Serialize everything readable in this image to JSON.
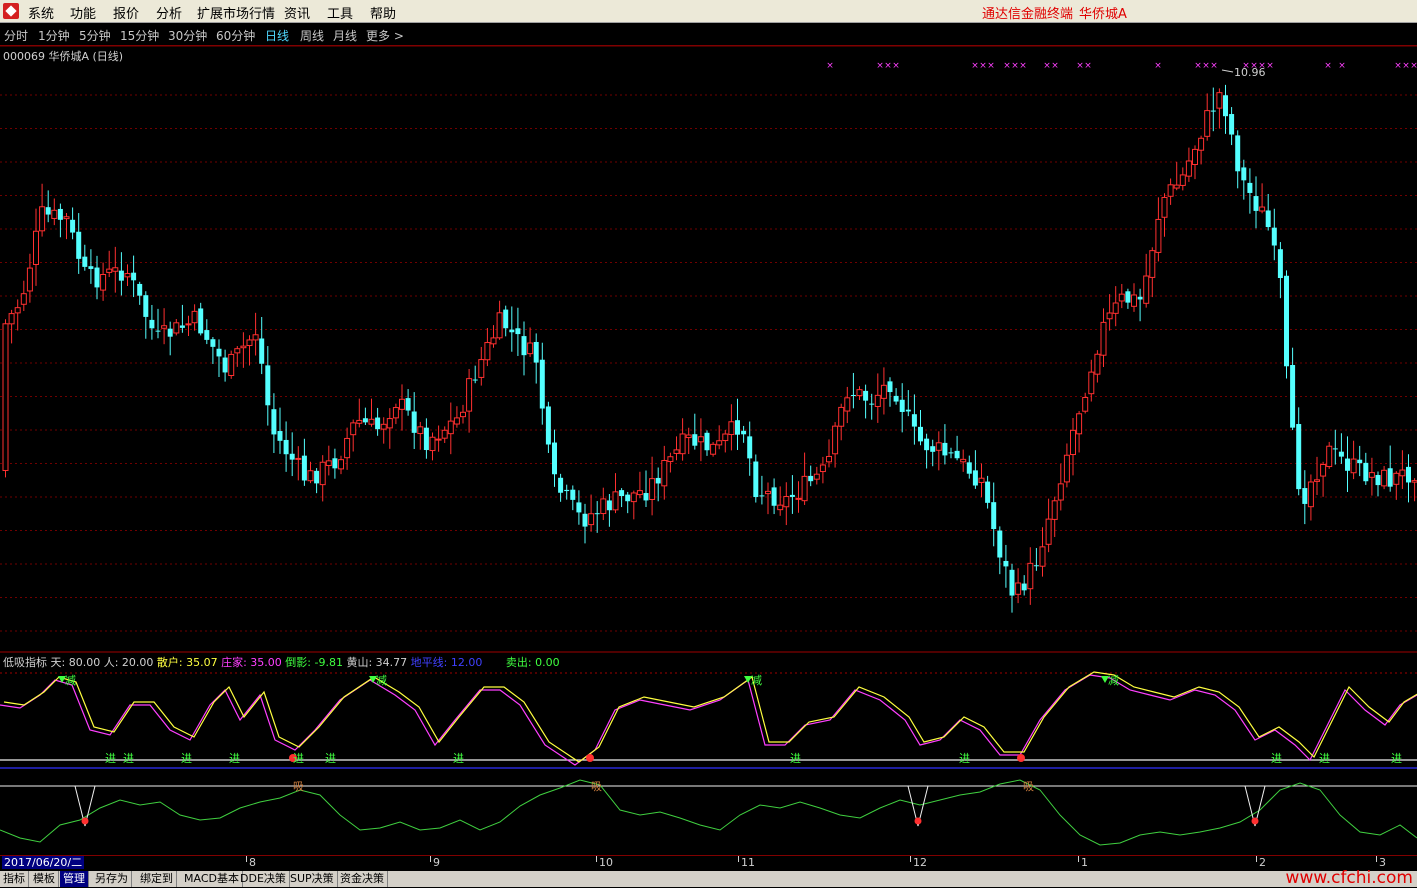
{
  "menu": {
    "items": [
      "系统",
      "功能",
      "报价",
      "分析",
      "扩展市场行情",
      "资讯",
      "工具",
      "帮助"
    ],
    "brand": "通达信金融终端",
    "stock_name": "华侨城A"
  },
  "periods": {
    "items": [
      "分时",
      "1分钟",
      "5分钟",
      "15分钟",
      "30分钟",
      "60分钟",
      "日线",
      "周线",
      "月线",
      "更多 >"
    ],
    "active": "日线"
  },
  "stock": {
    "title": "000069 华侨城A (日线)",
    "high_label": "10.96",
    "x_marks": "×"
  },
  "indicator": {
    "name": "低吸指标",
    "items": [
      {
        "label": "天: 80.00",
        "color": "#d0d0d0"
      },
      {
        "label": "人: 20.00",
        "color": "#d0d0d0"
      },
      {
        "label": "散户: 35.07",
        "color": "#ffff40"
      },
      {
        "label": "庄家: 35.00",
        "color": "#ff40ff"
      },
      {
        "label": "倒影: -9.81",
        "color": "#40ff40"
      },
      {
        "label": "黄山: 34.77",
        "color": "#d0d0d0"
      },
      {
        "label": "地平线: 12.00",
        "color": "#4040ff"
      },
      {
        "label": "卖出: 0.00",
        "color": "#40ff40"
      }
    ],
    "signals": {
      "sell": "减",
      "buy": "进",
      "absorb": "吸"
    }
  },
  "date_axis": {
    "cursor": "2017/06/20/二",
    "ticks": [
      "8",
      "9",
      "10",
      "11",
      "12",
      "1",
      "2",
      "3"
    ]
  },
  "tabs": {
    "items": [
      "指标",
      "模板",
      "管理",
      "另存为",
      "绑定到",
      "MACD基本",
      "DDE决策",
      "SUP决策",
      "资金决策"
    ],
    "active": "管理"
  },
  "watermark": "www.cfchi.com",
  "colors": {
    "up": "#ff3030",
    "down": "#54ffff",
    "grid": "#800000",
    "white_line": "#f0f0f0",
    "blue_line": "#3030ff"
  }
}
